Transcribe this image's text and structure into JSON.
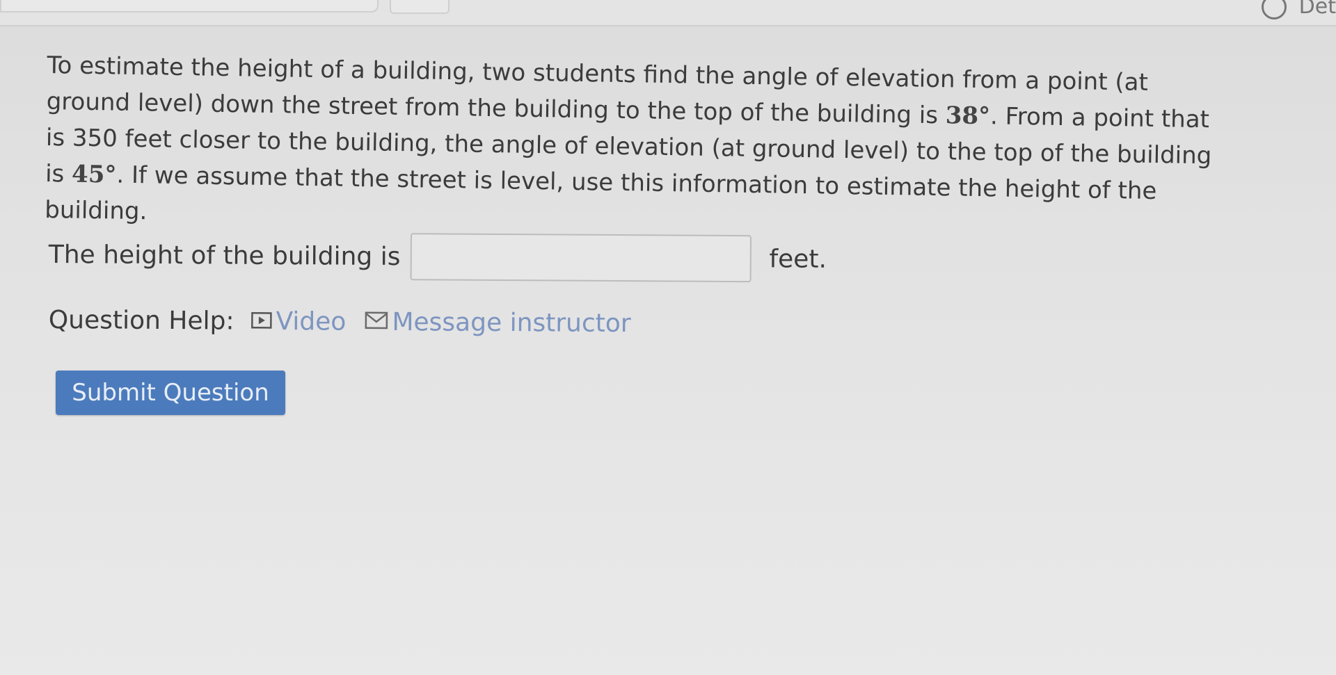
{
  "header": {
    "top_right_text": "Det"
  },
  "question": {
    "part1": "To estimate the height of a building, two students find the angle of elevation from a point (at ground level) down the street from the building to the top of the building is ",
    "angle1": "38°",
    "part2": ". From a point that is 350 feet closer to the building, the angle of elevation (at ground level) to the top of the building is ",
    "angle2": "45°",
    "part3": ". If we assume that the street is level, use this information to estimate the height of the building."
  },
  "answer": {
    "prefix": "The height of the building is",
    "value": "",
    "suffix": "feet."
  },
  "help": {
    "label": "Question Help:",
    "video_label": "Video",
    "message_label": "Message instructor"
  },
  "submit": {
    "label": "Submit Question"
  },
  "colors": {
    "link": "#7d95c0",
    "button": "#4b7bbc",
    "background": "#e2e2e2"
  }
}
